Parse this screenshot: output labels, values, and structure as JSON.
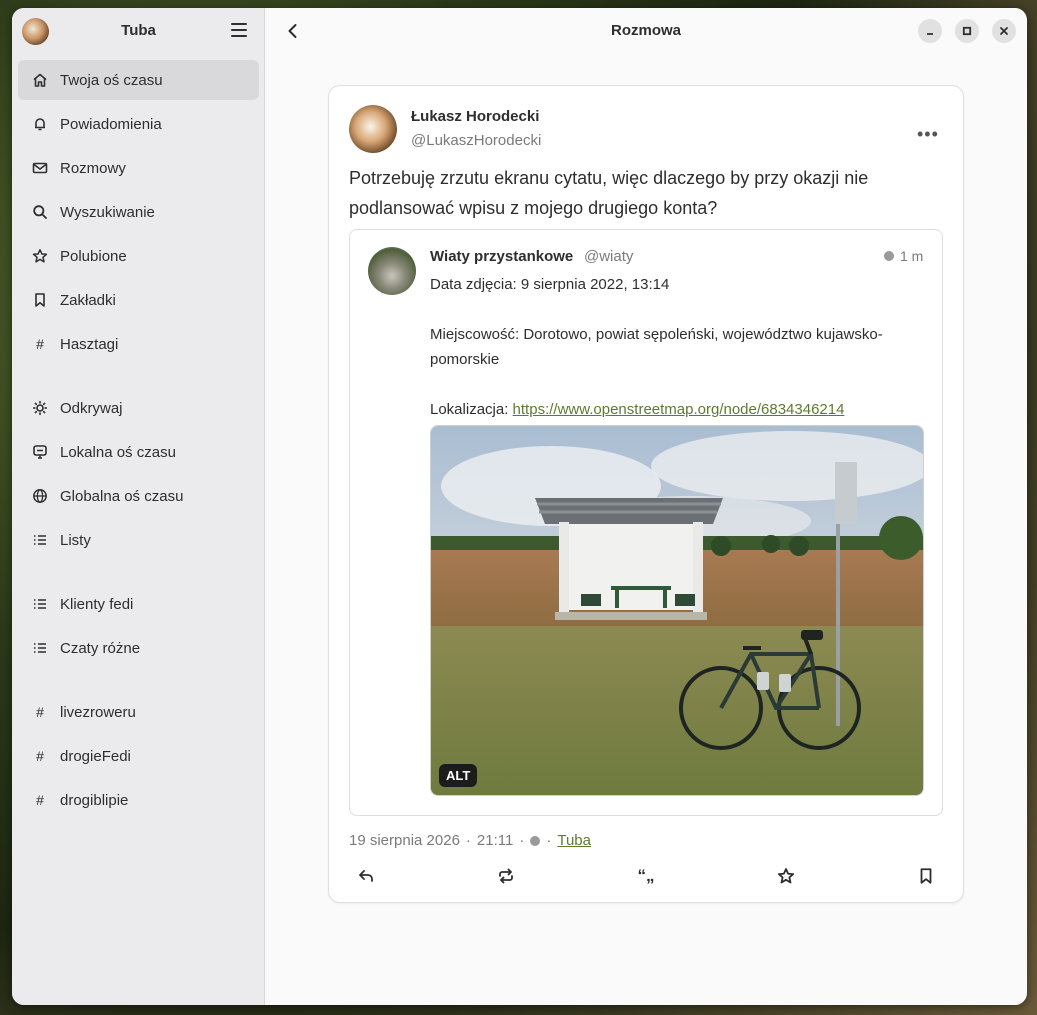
{
  "sidebar": {
    "title": "Tuba",
    "items": [
      {
        "label": "Twoja oś czasu",
        "icon": "home-icon",
        "active": true
      },
      {
        "label": "Powiadomienia",
        "icon": "bell-icon"
      },
      {
        "label": "Rozmowy",
        "icon": "mail-icon"
      },
      {
        "label": "Wyszukiwanie",
        "icon": "search-icon"
      },
      {
        "label": "Polubione",
        "icon": "star-icon"
      },
      {
        "label": "Zakładki",
        "icon": "bookmark-icon"
      },
      {
        "label": "Hasztagi",
        "icon": "hashtag-icon"
      },
      {
        "label": "Odkrywaj",
        "icon": "explore-icon"
      },
      {
        "label": "Lokalna oś czasu",
        "icon": "local-timeline-icon"
      },
      {
        "label": "Globalna oś czasu",
        "icon": "globe-icon"
      },
      {
        "label": "Listy",
        "icon": "list-icon"
      },
      {
        "label": "Klienty fedi",
        "icon": "list-icon"
      },
      {
        "label": "Czaty różne",
        "icon": "list-icon"
      },
      {
        "label": "livezroweru",
        "icon": "hashtag-icon"
      },
      {
        "label": "drogieFedi",
        "icon": "hashtag-icon"
      },
      {
        "label": "drogiblipie",
        "icon": "hashtag-icon"
      }
    ]
  },
  "header": {
    "title": "Rozmowa"
  },
  "post": {
    "author_name": "Łukasz Horodecki",
    "author_handle": "@LukaszHorodecki",
    "text": "Potrzebuję zrzutu ekranu cytatu, więc dlaczego by przy okazji nie podlansować wpisu z mojego drugiego konta?",
    "quote": {
      "name": "Wiaty przystankowe",
      "handle": "@wiaty",
      "time": "1 m",
      "line1": "Data zdjęcia: 9 sierpnia 2022, 13:14",
      "line2": "Miejscowość: Dorotowo, powiat sępoleński, województwo kujawsko-pomorskie",
      "line3_prefix": "Lokalizacja: ",
      "link": "https://www.openstreetmap.org/node/6834346214",
      "alt_label": "ALT"
    },
    "date": "19 sierpnia 2026",
    "time": "21:11",
    "client": "Tuba",
    "sep": "·"
  },
  "colors": {
    "accent_link": "#5c7c2a",
    "window_bg": "#fafafa",
    "sidebar_bg": "#ebebed"
  }
}
